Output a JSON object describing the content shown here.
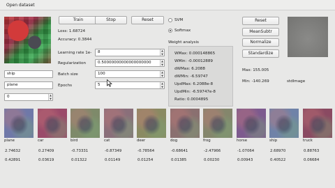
{
  "menu": {
    "open_dataset": "Open dataset"
  },
  "buttons": {
    "train": "Train",
    "stop": "Stop",
    "reset": "Reset"
  },
  "stats": {
    "loss": "Loss: 1.68724",
    "accuracy": "Accuracy: 0.3844"
  },
  "params": {
    "learning_rate_label": "Learning rate 1e-",
    "learning_rate_value": "8",
    "regularization_label": "Regularization",
    "regularization_value": "0.50000000000000000000",
    "batch_size_label": "Batch size",
    "batch_size_value": "100",
    "epochs_label": "Epochs",
    "epochs_value": "5"
  },
  "left_inputs": {
    "class_a": "ship",
    "class_b": "plane",
    "index": "0"
  },
  "classifier": {
    "svm": "SVM",
    "softmax": "Softmax",
    "selected": "Softmax"
  },
  "weight_analysis": {
    "title": "Weight analysis",
    "lines": [
      "WMax: 0.000148865",
      "WMin: -0.00012889",
      "dWMax: 6.2088",
      "dWMin: -6.59747",
      "UpdMax: 6.2088e-8",
      "UpdMin: -6.59747e-8",
      "Ratio: 0.0004895"
    ]
  },
  "preprocess": {
    "reset": "Reset",
    "mean_subtr": "MeanSubtr",
    "normalize": "Normalize",
    "standardize": "Standardize"
  },
  "image_stats": {
    "max": "Max: 155.005",
    "min": "Min: -140.269",
    "label": "stdImage"
  },
  "classes": [
    {
      "name": "plane",
      "score": "2.74632",
      "prob": "0.42891",
      "color": "#6f78a8"
    },
    {
      "name": "car",
      "score": "0.27409",
      "prob": "0.03619",
      "color": "#9a4a6a"
    },
    {
      "name": "bird",
      "score": "-0.73331",
      "prob": "0.01322",
      "color": "#7e8a6a"
    },
    {
      "name": "cat",
      "score": "-0.87349",
      "prob": "0.01149",
      "color": "#8a6f7a"
    },
    {
      "name": "deer",
      "score": "-0.78564",
      "prob": "0.01254",
      "color": "#8a8a62"
    },
    {
      "name": "dog",
      "score": "-0.68641",
      "prob": "0.01385",
      "color": "#8a7070"
    },
    {
      "name": "frog",
      "score": "-2.47966",
      "prob": "0.00230",
      "color": "#84866c"
    },
    {
      "name": "horse",
      "score": "-1.07064",
      "prob": "0.00943",
      "color": "#7d5a8e"
    },
    {
      "name": "ship",
      "score": "2.68970",
      "prob": "0.40522",
      "color": "#6f82a8"
    },
    {
      "name": "truck",
      "score": "0.88763",
      "prob": "0.06684",
      "color": "#8a4a62"
    }
  ]
}
